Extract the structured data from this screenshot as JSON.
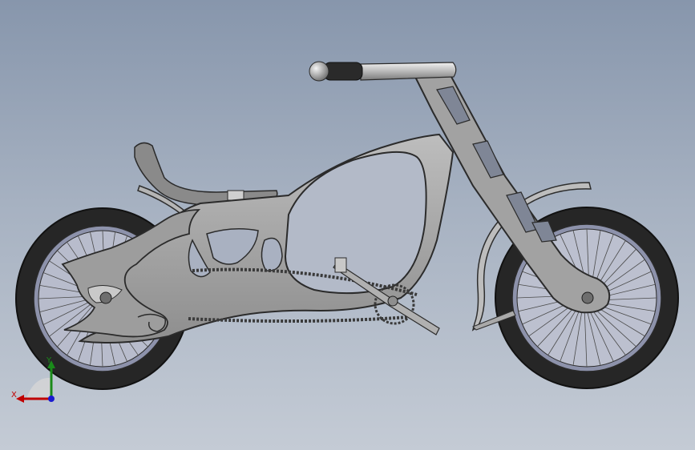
{
  "scene": {
    "model": "chopper-bicycle",
    "colors": {
      "background_top": "#8796ac",
      "background_bottom": "#c4cbd5",
      "frame_fill": "#a8a8a8",
      "frame_edge": "#2e2e2e",
      "tire": "#232323",
      "rim": "#8a8fa8",
      "chrome": "#c9c9c9"
    }
  },
  "triad": {
    "x_label": "X",
    "y_label": "Y",
    "x_color": "#c00000",
    "y_color": "#1a8a1a",
    "z_color": "#1a1ad0"
  }
}
